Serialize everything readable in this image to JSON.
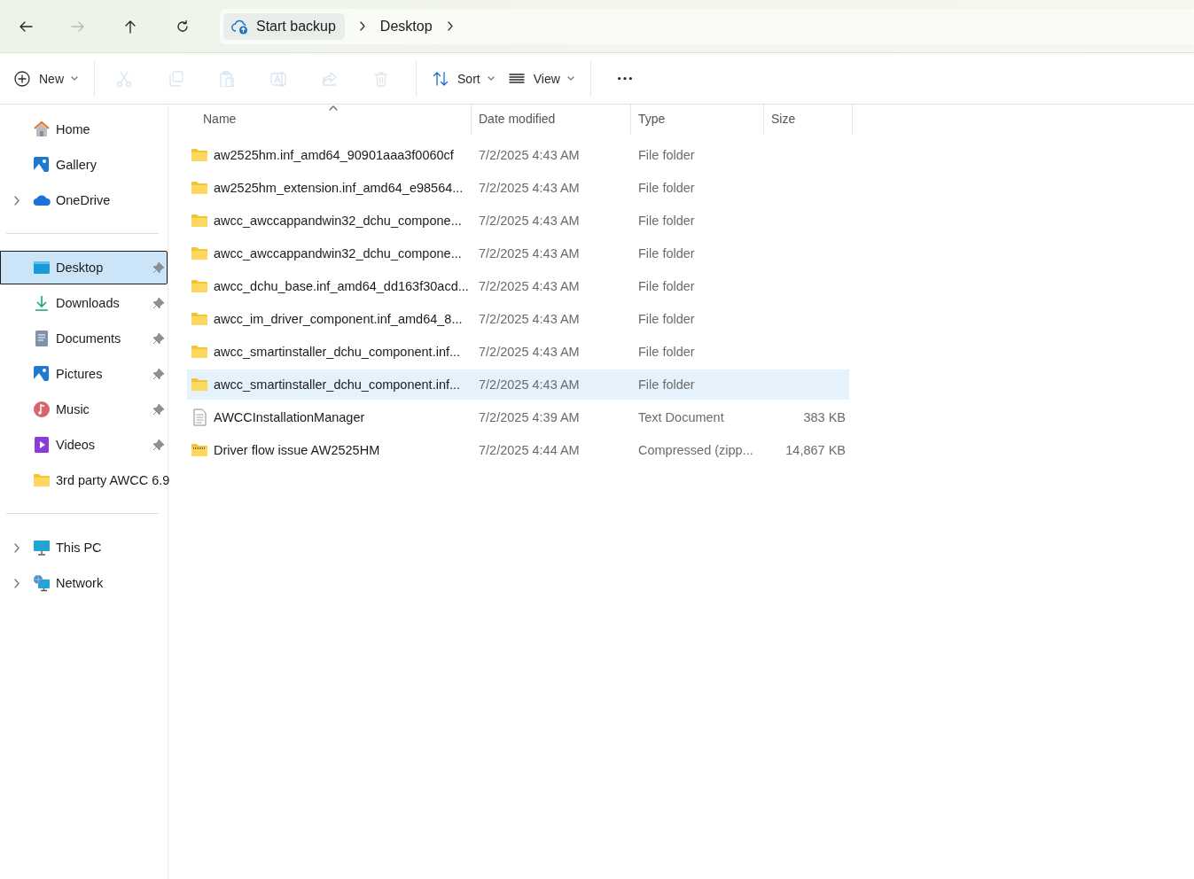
{
  "navigation": [
    {
      "kind": "back",
      "disabled": false
    },
    {
      "kind": "forward",
      "disabled": true
    },
    {
      "kind": "up",
      "disabled": false
    },
    {
      "kind": "refresh",
      "disabled": false
    }
  ],
  "address_bar": {
    "backup_label": "Start backup",
    "crumbs": [
      "Desktop"
    ]
  },
  "toolbar": [
    {
      "kind": "new",
      "label": "New",
      "disabled": false
    },
    {
      "kind": "cut",
      "disabled": true
    },
    {
      "kind": "copy",
      "disabled": true
    },
    {
      "kind": "paste",
      "disabled": true
    },
    {
      "kind": "rename",
      "disabled": true
    },
    {
      "kind": "share",
      "disabled": true
    },
    {
      "kind": "delete",
      "disabled": true
    },
    {
      "kind": "sort",
      "label": "Sort",
      "disabled": false
    },
    {
      "kind": "view",
      "label": "View",
      "disabled": false
    },
    {
      "kind": "more",
      "disabled": false
    }
  ],
  "sidebar": {
    "groups": [
      {
        "items": [
          {
            "label": "Home",
            "kind": "home",
            "expandable": false,
            "pinned": false,
            "selected": false
          },
          {
            "label": "Gallery",
            "kind": "gallery",
            "expandable": false,
            "pinned": false,
            "selected": false
          },
          {
            "label": "OneDrive",
            "kind": "cloud",
            "expandable": true,
            "pinned": false,
            "selected": false
          }
        ]
      },
      {
        "items": [
          {
            "label": "Desktop",
            "kind": "desktop",
            "expandable": false,
            "pinned": true,
            "selected": true
          },
          {
            "label": "Downloads",
            "kind": "download",
            "expandable": false,
            "pinned": true,
            "selected": false
          },
          {
            "label": "Documents",
            "kind": "document",
            "expandable": false,
            "pinned": true,
            "selected": false
          },
          {
            "label": "Pictures",
            "kind": "gallery",
            "expandable": false,
            "pinned": true,
            "selected": false
          },
          {
            "label": "Music",
            "kind": "music",
            "expandable": false,
            "pinned": true,
            "selected": false
          },
          {
            "label": "Videos",
            "kind": "video",
            "expandable": false,
            "pinned": true,
            "selected": false
          },
          {
            "label": "3rd party AWCC 6.9",
            "kind": "folder",
            "expandable": false,
            "pinned": false,
            "selected": false
          }
        ]
      },
      {
        "items": [
          {
            "label": "This PC",
            "kind": "pc",
            "expandable": true,
            "pinned": false,
            "selected": false
          },
          {
            "label": "Network",
            "kind": "network",
            "expandable": true,
            "pinned": false,
            "selected": false
          }
        ]
      }
    ]
  },
  "table": {
    "columns": [
      {
        "label": "Name",
        "sorted": true
      },
      {
        "label": "Date modified",
        "sorted": false
      },
      {
        "label": "Type",
        "sorted": false
      },
      {
        "label": "Size",
        "sorted": false
      }
    ],
    "rows": [
      {
        "kind": "folder",
        "name": "aw2525hm.inf_amd64_90901aaa3f0060cf",
        "date": "7/2/2025 4:43 AM",
        "type": "File folder",
        "hovered": false
      },
      {
        "kind": "folder",
        "name": "aw2525hm_extension.inf_amd64_e98564...",
        "date": "7/2/2025 4:43 AM",
        "type": "File folder",
        "hovered": false
      },
      {
        "kind": "folder",
        "name": "awcc_awccappandwin32_dchu_compone...",
        "date": "7/2/2025 4:43 AM",
        "type": "File folder",
        "hovered": false
      },
      {
        "kind": "folder",
        "name": "awcc_awccappandwin32_dchu_compone...",
        "date": "7/2/2025 4:43 AM",
        "type": "File folder",
        "hovered": false
      },
      {
        "kind": "folder",
        "name": "awcc_dchu_base.inf_amd64_dd163f30acd...",
        "date": "7/2/2025 4:43 AM",
        "type": "File folder",
        "hovered": false
      },
      {
        "kind": "folder",
        "name": "awcc_im_driver_component.inf_amd64_8...",
        "date": "7/2/2025 4:43 AM",
        "type": "File folder",
        "hovered": false
      },
      {
        "kind": "folder",
        "name": "awcc_smartinstaller_dchu_component.inf...",
        "date": "7/2/2025 4:43 AM",
        "type": "File folder",
        "hovered": false
      },
      {
        "kind": "folder",
        "name": "awcc_smartinstaller_dchu_component.inf...",
        "date": "7/2/2025 4:43 AM",
        "type": "File folder",
        "hovered": true
      },
      {
        "kind": "text",
        "name": "AWCCInstallationManager",
        "date": "7/2/2025 4:39 AM",
        "type": "Text Document",
        "size": "383 KB",
        "hovered": false
      },
      {
        "kind": "zip",
        "name": "Driver flow issue AW2525HM",
        "date": "7/2/2025 4:44 AM",
        "type": "Compressed (zipp...",
        "size": "14,867 KB",
        "hovered": false
      }
    ]
  }
}
